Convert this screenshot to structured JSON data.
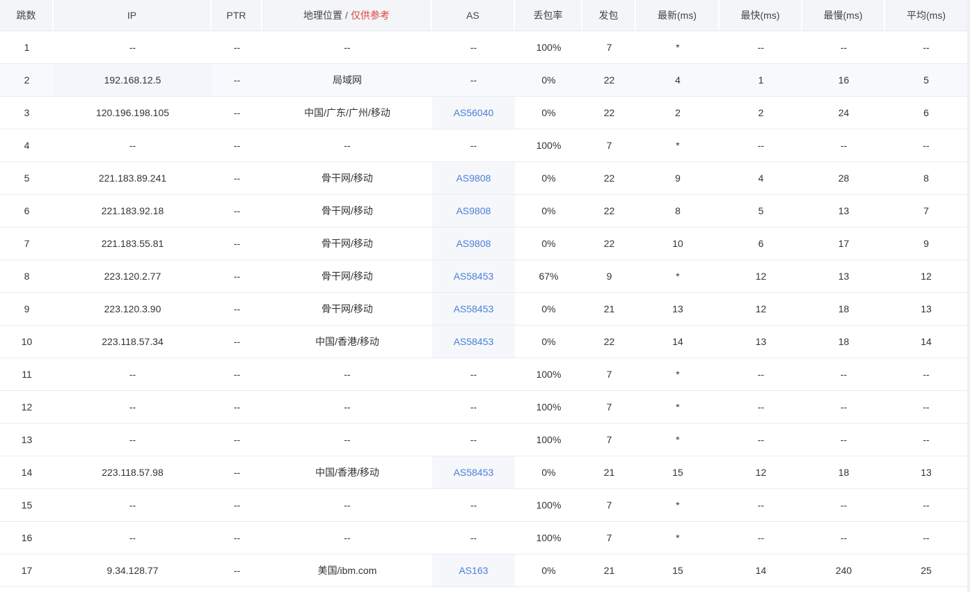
{
  "header": {
    "hop": "跳数",
    "ip": "IP",
    "ptr": "PTR",
    "geo_label": "地理位置",
    "geo_sep": "/",
    "geo_note": "仅供参考",
    "as": "AS",
    "loss": "丢包率",
    "sent": "发包",
    "last": "最新(ms)",
    "best": "最快(ms)",
    "worst": "最慢(ms)",
    "avg": "平均(ms)"
  },
  "colors": {
    "link": "#4a7fd6",
    "note": "#e0463e",
    "header_bg": "#f3f5f8"
  },
  "rows": [
    {
      "hop": "1",
      "ip": "--",
      "ptr": "--",
      "geo": "--",
      "as": "--",
      "loss": "100%",
      "sent": "7",
      "last": "*",
      "best": "--",
      "worst": "--",
      "avg": "--"
    },
    {
      "hop": "2",
      "ip": "192.168.12.5",
      "ptr": "--",
      "geo": "局域网",
      "as": "--",
      "loss": "0%",
      "sent": "22",
      "last": "4",
      "best": "1",
      "worst": "16",
      "avg": "5"
    },
    {
      "hop": "3",
      "ip": "120.196.198.105",
      "ptr": "--",
      "geo": "中国/广东/广州/移动",
      "as": "AS56040",
      "loss": "0%",
      "sent": "22",
      "last": "2",
      "best": "2",
      "worst": "24",
      "avg": "6"
    },
    {
      "hop": "4",
      "ip": "--",
      "ptr": "--",
      "geo": "--",
      "as": "--",
      "loss": "100%",
      "sent": "7",
      "last": "*",
      "best": "--",
      "worst": "--",
      "avg": "--"
    },
    {
      "hop": "5",
      "ip": "221.183.89.241",
      "ptr": "--",
      "geo": "骨干网/移动",
      "as": "AS9808",
      "loss": "0%",
      "sent": "22",
      "last": "9",
      "best": "4",
      "worst": "28",
      "avg": "8"
    },
    {
      "hop": "6",
      "ip": "221.183.92.18",
      "ptr": "--",
      "geo": "骨干网/移动",
      "as": "AS9808",
      "loss": "0%",
      "sent": "22",
      "last": "8",
      "best": "5",
      "worst": "13",
      "avg": "7"
    },
    {
      "hop": "7",
      "ip": "221.183.55.81",
      "ptr": "--",
      "geo": "骨干网/移动",
      "as": "AS9808",
      "loss": "0%",
      "sent": "22",
      "last": "10",
      "best": "6",
      "worst": "17",
      "avg": "9"
    },
    {
      "hop": "8",
      "ip": "223.120.2.77",
      "ptr": "--",
      "geo": "骨干网/移动",
      "as": "AS58453",
      "loss": "67%",
      "sent": "9",
      "last": "*",
      "best": "12",
      "worst": "13",
      "avg": "12"
    },
    {
      "hop": "9",
      "ip": "223.120.3.90",
      "ptr": "--",
      "geo": "骨干网/移动",
      "as": "AS58453",
      "loss": "0%",
      "sent": "21",
      "last": "13",
      "best": "12",
      "worst": "18",
      "avg": "13"
    },
    {
      "hop": "10",
      "ip": "223.118.57.34",
      "ptr": "--",
      "geo": "中国/香港/移动",
      "as": "AS58453",
      "loss": "0%",
      "sent": "22",
      "last": "14",
      "best": "13",
      "worst": "18",
      "avg": "14"
    },
    {
      "hop": "11",
      "ip": "--",
      "ptr": "--",
      "geo": "--",
      "as": "--",
      "loss": "100%",
      "sent": "7",
      "last": "*",
      "best": "--",
      "worst": "--",
      "avg": "--"
    },
    {
      "hop": "12",
      "ip": "--",
      "ptr": "--",
      "geo": "--",
      "as": "--",
      "loss": "100%",
      "sent": "7",
      "last": "*",
      "best": "--",
      "worst": "--",
      "avg": "--"
    },
    {
      "hop": "13",
      "ip": "--",
      "ptr": "--",
      "geo": "--",
      "as": "--",
      "loss": "100%",
      "sent": "7",
      "last": "*",
      "best": "--",
      "worst": "--",
      "avg": "--"
    },
    {
      "hop": "14",
      "ip": "223.118.57.98",
      "ptr": "--",
      "geo": "中国/香港/移动",
      "as": "AS58453",
      "loss": "0%",
      "sent": "21",
      "last": "15",
      "best": "12",
      "worst": "18",
      "avg": "13"
    },
    {
      "hop": "15",
      "ip": "--",
      "ptr": "--",
      "geo": "--",
      "as": "--",
      "loss": "100%",
      "sent": "7",
      "last": "*",
      "best": "--",
      "worst": "--",
      "avg": "--"
    },
    {
      "hop": "16",
      "ip": "--",
      "ptr": "--",
      "geo": "--",
      "as": "--",
      "loss": "100%",
      "sent": "7",
      "last": "*",
      "best": "--",
      "worst": "--",
      "avg": "--"
    },
    {
      "hop": "17",
      "ip": "9.34.128.77",
      "ptr": "--",
      "geo": "美国/ibm.com",
      "as": "AS163",
      "loss": "0%",
      "sent": "21",
      "last": "15",
      "best": "14",
      "worst": "240",
      "avg": "25"
    }
  ]
}
